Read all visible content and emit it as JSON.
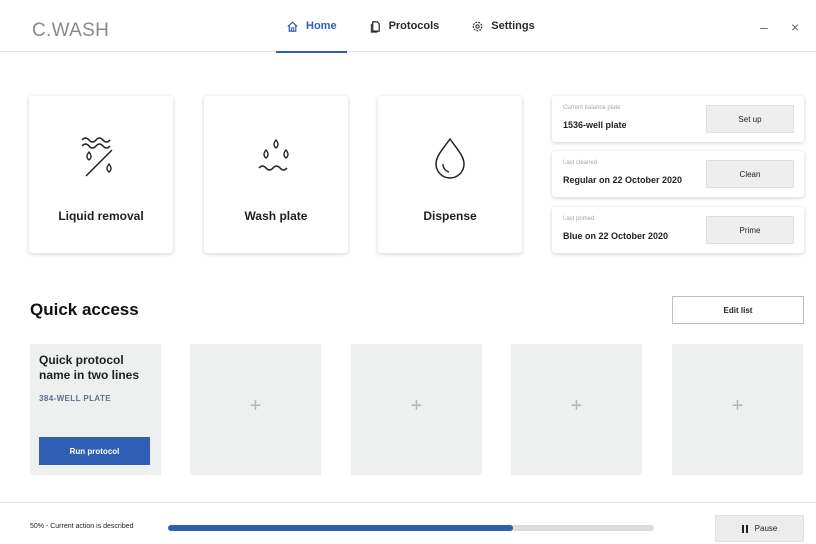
{
  "app": {
    "title": "C.WASH"
  },
  "nav": [
    {
      "label": "Home",
      "icon": "home-icon",
      "active": true
    },
    {
      "label": "Protocols",
      "icon": "document-icon",
      "active": false
    },
    {
      "label": "Settings",
      "icon": "gear-icon",
      "active": false
    }
  ],
  "window": {
    "minimize": "–",
    "close": "×"
  },
  "tiles": [
    {
      "label": "Liquid removal",
      "icon": "liquid-removal-icon"
    },
    {
      "label": "Wash plate",
      "icon": "wash-plate-icon"
    },
    {
      "label": "Dispense",
      "icon": "droplet-icon"
    }
  ],
  "status": [
    {
      "caption": "Current balance plate",
      "value": "1536-well plate",
      "button": "Set up"
    },
    {
      "caption": "Last cleaned",
      "value": "Regular on 22 October 2020",
      "button": "Clean"
    },
    {
      "caption": "Last primed",
      "value": "Blue on 22 October 2020",
      "button": "Prime"
    }
  ],
  "quick_access": {
    "title": "Quick access",
    "edit_label": "Edit list",
    "protocol": {
      "name": "Quick protocol name in two lines",
      "plate": "384-WELL PLATE",
      "run_label": "Run protocol"
    },
    "empty_slot_symbol": "+"
  },
  "progress": {
    "label": "50% - Current action is described",
    "fraction": 0.71
  },
  "pause_label": "Pause",
  "colors": {
    "accent": "#2f5fb3",
    "card_bg": "#eef0f0"
  }
}
